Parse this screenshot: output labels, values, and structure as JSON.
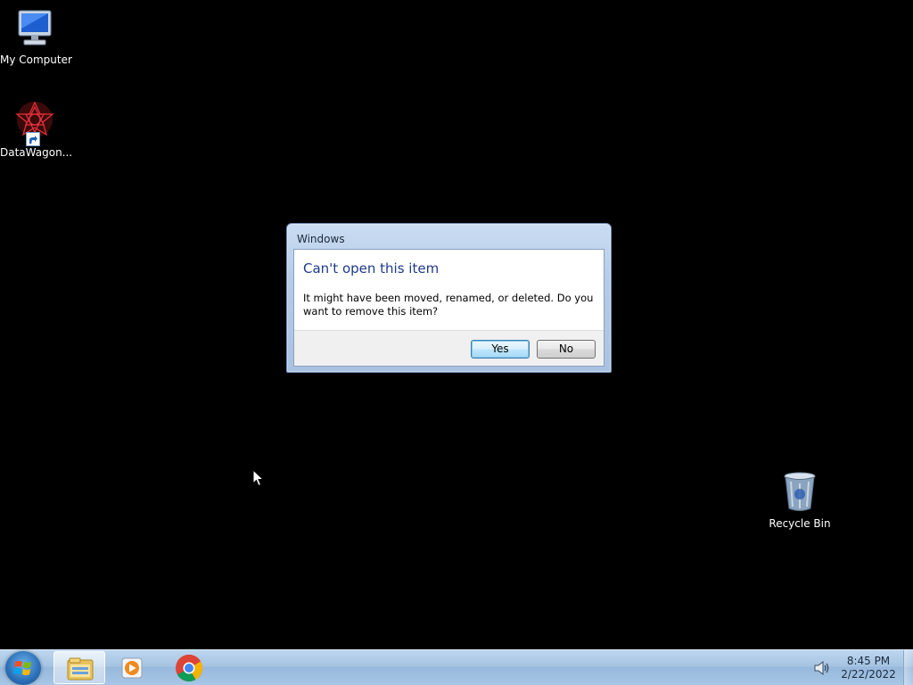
{
  "desktop": {
    "icons": [
      {
        "label": "My Computer",
        "icon": "my-computer-icon"
      },
      {
        "label": "DataWagon...",
        "icon": "datawagon-icon"
      },
      {
        "label": "Recycle Bin",
        "icon": "recycle-bin-icon"
      }
    ]
  },
  "dialog": {
    "title": "Windows",
    "heading": "Can't open this item",
    "message": "It might have been moved, renamed, or deleted. Do you want to remove this item?",
    "yes_label": "Yes",
    "no_label": "No"
  },
  "taskbar": {
    "pinned": [
      {
        "icon": "windows-explorer-icon"
      },
      {
        "icon": "media-player-icon"
      },
      {
        "icon": "chrome-icon"
      }
    ],
    "tray": {
      "volume_icon": "speaker-icon"
    },
    "clock": {
      "time": "8:45 PM",
      "date": "2/22/2022"
    }
  },
  "colors": {
    "desktop_background": "#000000",
    "heading": "#1e3a8a",
    "taskbar": "#a6c4e2"
  }
}
